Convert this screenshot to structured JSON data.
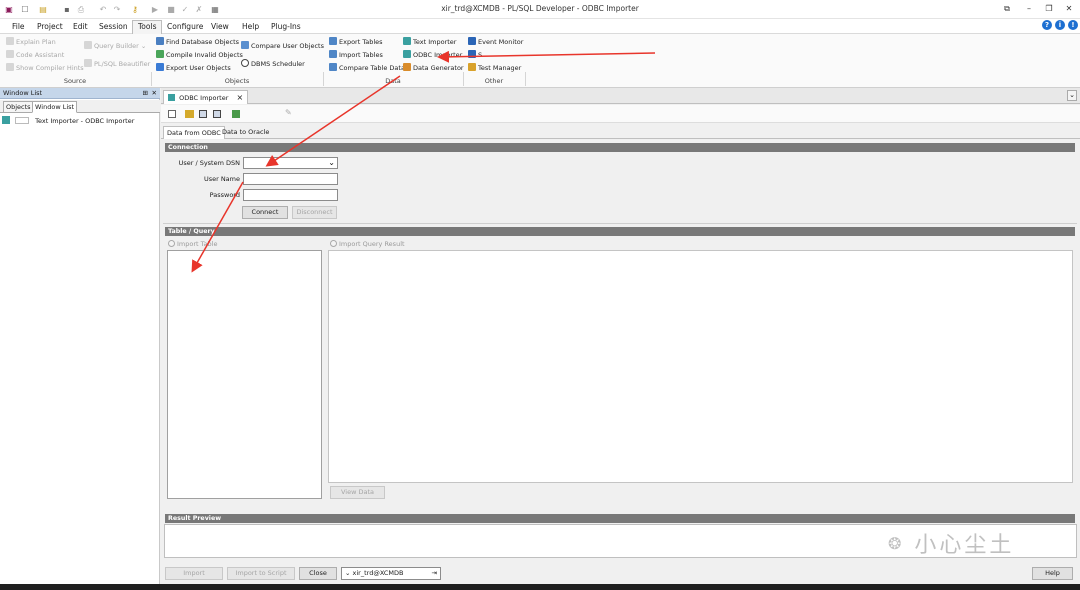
{
  "window": {
    "title": "xir_trd@XCMDB - PL/SQL Developer - ODBC Importer"
  },
  "menu": [
    "File",
    "Project",
    "Edit",
    "Session",
    "Tools",
    "Configure",
    "View",
    "Help",
    "Plug-Ins"
  ],
  "ribbon": {
    "source": {
      "explain_plan": "Explain Plan",
      "code_assistant": "Code Assistant",
      "show_compiler_hints": "Show Compiler Hints",
      "query_builder": "Query Builder",
      "beautifier": "PL/SQL Beautifier",
      "label": "Source"
    },
    "objects": {
      "find_db_objects": "Find Database Objects",
      "compile_invalid": "Compile Invalid Objects",
      "export_user_objects": "Export User Objects",
      "compare_user_objects": "Compare User Objects",
      "dbms_scheduler": "DBMS Scheduler",
      "label": "Objects"
    },
    "data": {
      "export_tables": "Export Tables",
      "import_tables": "Import Tables",
      "compare_table_data": "Compare Table Data",
      "text_importer": "Text Importer",
      "odbc_importer": "ODBC Importer",
      "data_generator": "Data Generator",
      "label": "Data"
    },
    "other": {
      "event_monitor": "Event Monitor",
      "sessions": "S",
      "test_manager": "Test Manager",
      "label": "Other"
    }
  },
  "left_panel": {
    "header": "Window List",
    "tabs": [
      "Objects",
      "Window List"
    ],
    "items": [
      "Text Importer - ODBC Importer"
    ]
  },
  "doc": {
    "tab": "ODBC Importer",
    "subtabs": [
      "Data from ODBC",
      "Data to Oracle"
    ],
    "connection": {
      "section": "Connection",
      "dsn_label": "User / System DSN",
      "user_label": "User Name",
      "password_label": "Password",
      "dsn_value": "",
      "user_value": "",
      "password_value": "",
      "connect": "Connect",
      "disconnect": "Disconnect"
    },
    "table_query": {
      "section": "Table / Query",
      "import_table": "Import Table",
      "import_query_result": "Import Query Result",
      "view_data": "View Data"
    },
    "result_preview": {
      "section": "Result Preview"
    },
    "footer": {
      "import": "Import",
      "import_to_script": "Import to Script",
      "close": "Close",
      "connection": "xir_trd@XCMDB",
      "help": "Help"
    }
  },
  "watermark": "小心尘土",
  "colors": {
    "section_head": "#787878",
    "arrow": "#e8352b",
    "panel_header": "#c5d6ea",
    "help_blue": "#1d6fd1"
  }
}
